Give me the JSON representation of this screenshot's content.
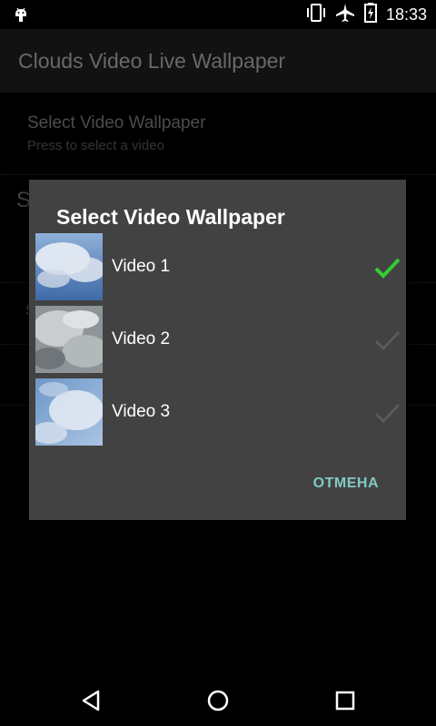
{
  "status_bar": {
    "time": "18:33",
    "icons": [
      "android-icon",
      "vibrate-icon",
      "airplane-mode-icon",
      "battery-icon"
    ]
  },
  "app_bar": {
    "title": "Clouds Video Live Wallpaper"
  },
  "preferences": {
    "select_video": {
      "title": "Select Video Wallpaper",
      "summary": "Press to select a video"
    },
    "partial_item_letter_1": "S",
    "partial_item_letter_2": "S"
  },
  "dialog": {
    "title": "Select Video Wallpaper",
    "items": [
      {
        "label": "Video 1",
        "selected": true
      },
      {
        "label": "Video 2",
        "selected": false
      },
      {
        "label": "Video 3",
        "selected": false
      }
    ],
    "cancel_label": "ОТМЕНА"
  },
  "colors": {
    "accent_check": "#33cc33",
    "cancel_text": "#80cbc4",
    "dialog_bg": "#424242"
  },
  "nav_bar": {
    "icons": [
      "back-icon",
      "home-icon",
      "recents-icon"
    ]
  }
}
